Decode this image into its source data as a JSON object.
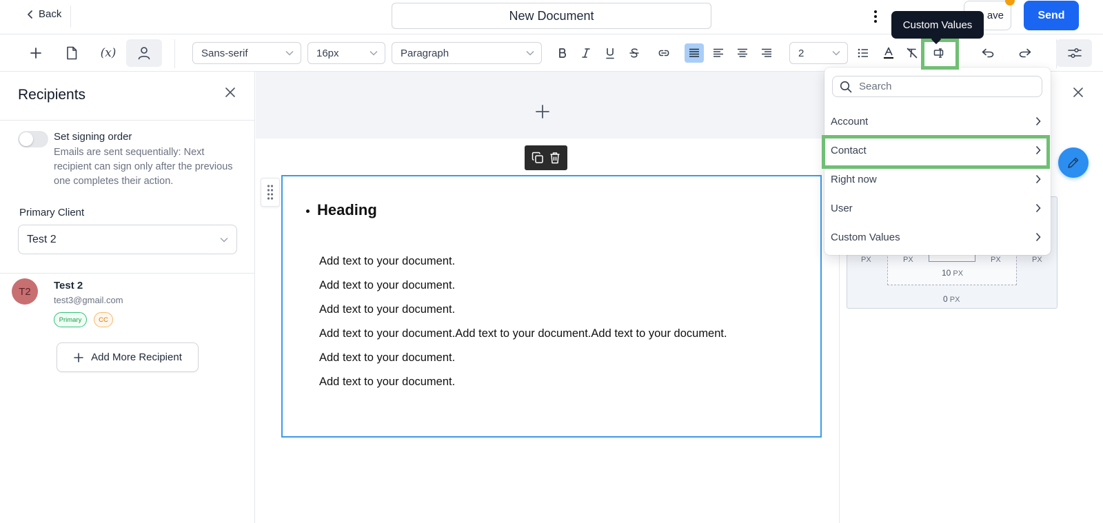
{
  "header": {
    "back_label": "Back",
    "document_title": "New Document",
    "save_label": "ave",
    "send_label": "Send",
    "tooltip": "Custom Values"
  },
  "toolbar": {
    "font_family": "Sans-serif",
    "font_size": "16px",
    "block_type": "Paragraph",
    "line_height": "2",
    "variable_icon_text": "(x)",
    "active_tool": "recipients"
  },
  "sidebar": {
    "title": "Recipients",
    "signing_order_label": "Set signing order",
    "signing_order_enabled": false,
    "signing_order_desc": "Emails are sent sequentially: Next recipient can sign only after the previous one completes their action.",
    "primary_client_label": "Primary Client",
    "primary_client_value": "Test 2",
    "recipient": {
      "initials": "T2",
      "name": "Test 2",
      "email": "test3@gmail.com",
      "badges": [
        "Primary",
        "CC"
      ]
    },
    "add_more_label": "Add More Recipient"
  },
  "document": {
    "heading": "Heading",
    "lines": [
      "Add text to your document.",
      "Add text to your document.",
      "Add text to your document.",
      "Add text to your document.Add text to your document.Add text to your document.",
      "Add text to your document.",
      "Add text to your document."
    ]
  },
  "dropdown": {
    "search_placeholder": "Search",
    "items": [
      "Account",
      "Contact",
      "Right now",
      "User",
      "Custom Values"
    ],
    "highlighted": "Contact"
  },
  "box_model": {
    "left_outer": "PX",
    "left_inner": "PX",
    "right_inner": "PX",
    "right_outer": "PX",
    "padding_bottom_value": "10",
    "padding_bottom_unit": "PX",
    "margin_bottom_value": "0",
    "margin_bottom_unit": "PX"
  },
  "colors": {
    "accent": "#1a66f2",
    "highlight": "#6fbf73",
    "selection": "#3b9ae9"
  }
}
